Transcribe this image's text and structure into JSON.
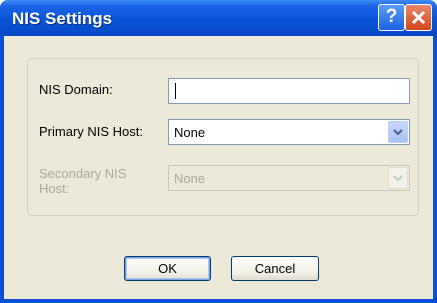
{
  "window": {
    "title": "NIS Settings"
  },
  "titlebar": {
    "help_glyph": "?"
  },
  "form": {
    "domain_label": "NIS Domain:",
    "domain_value": "",
    "primary_label": "Primary NIS Host:",
    "primary_value": "None",
    "secondary_label": "Secondary NIS Host:",
    "secondary_value": "None",
    "secondary_enabled": false
  },
  "buttons": {
    "ok": "OK",
    "cancel": "Cancel"
  },
  "colors": {
    "title_bar": "#0a54d8",
    "client_bg": "#ece9d8",
    "close_button": "#d2461d",
    "disabled_text": "#aca899"
  },
  "icons": [
    "help-icon",
    "close-icon",
    "chevron-down-icon"
  ]
}
